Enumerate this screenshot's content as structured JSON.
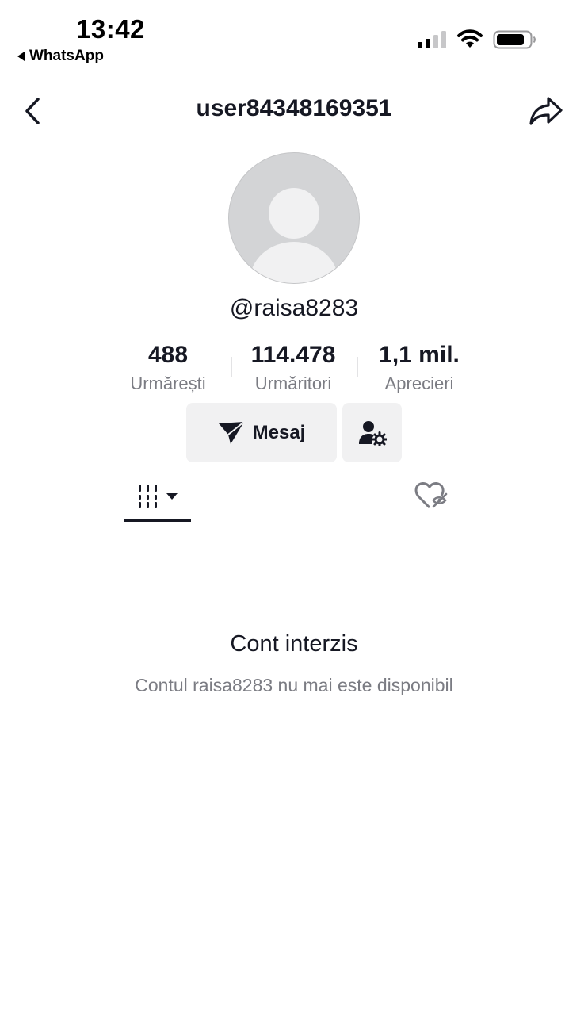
{
  "status_bar": {
    "time": "13:42",
    "back_app": "WhatsApp",
    "icons": [
      "signal-icon",
      "wifi-icon",
      "battery-icon"
    ]
  },
  "header": {
    "title": "user84348169351",
    "icons": [
      "back-chevron-icon",
      "share-arrow-icon"
    ]
  },
  "profile": {
    "handle": "@raisa8283",
    "avatar": "default-avatar"
  },
  "stats": [
    {
      "value": "488",
      "label": "Urmărești"
    },
    {
      "value": "114.478",
      "label": "Urmăritori"
    },
    {
      "value": "1,1 mil.",
      "label": "Aprecieri"
    }
  ],
  "actions": {
    "message_label": "Mesaj",
    "message_icon": "paper-plane-icon",
    "friend_icon": "user-settings-icon"
  },
  "tabs": [
    {
      "icon": "grid-dropdown-icon",
      "active": true
    },
    {
      "icon": "liked-hidden-icon",
      "active": false
    }
  ],
  "empty_state": {
    "title": "Cont interzis",
    "description": "Contul raisa8283 nu mai este disponibil"
  },
  "colors": {
    "text_primary": "#161823",
    "text_secondary": "#7b7c83",
    "button_bg": "#f1f1f2",
    "avatar_bg": "#d3d4d6"
  }
}
